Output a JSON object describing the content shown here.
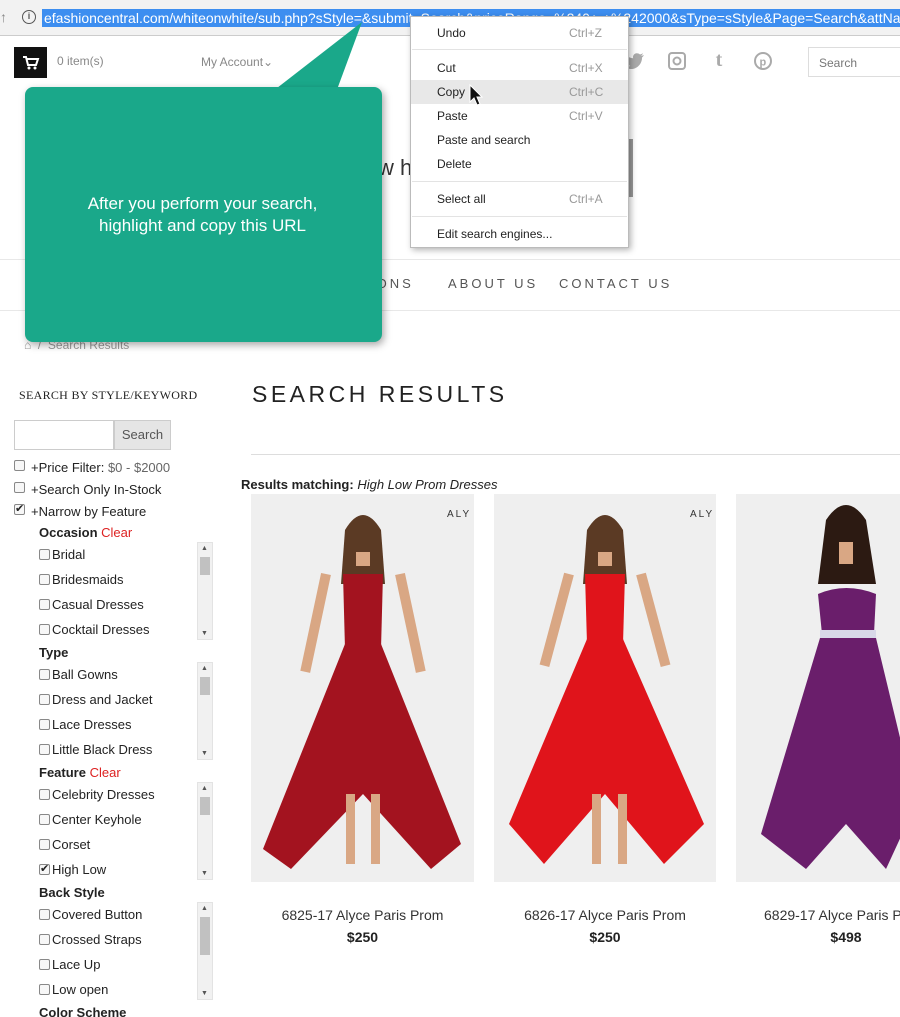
{
  "browser": {
    "url": "efashioncentral.com/whiteonwhite/sub.php?sStyle=&submit=Search&priceRange=%240+-+%242000&sType=sStyle&Page=Search&attNa"
  },
  "header": {
    "cart_count": "0 item(s)",
    "account": "My Account",
    "search_placeholder": "Search",
    "logo_fragment": "w h",
    "nav": [
      "IONS",
      "ABOUT US",
      "CONTACT US"
    ],
    "breadcrumb": "Search Results"
  },
  "callout": {
    "text": "After you perform your search, highlight and copy this URL",
    "color": "#1aa88a"
  },
  "context_menu": {
    "items": [
      {
        "label": "Undo",
        "shortcut": "Ctrl+Z"
      },
      {
        "label": "Cut",
        "shortcut": "Ctrl+X"
      },
      {
        "label": "Copy",
        "shortcut": "Ctrl+C"
      },
      {
        "label": "Paste",
        "shortcut": "Ctrl+V"
      },
      {
        "label": "Paste and search",
        "shortcut": ""
      },
      {
        "label": "Delete",
        "shortcut": ""
      },
      {
        "label": "Select all",
        "shortcut": "Ctrl+A"
      },
      {
        "label": "Edit search engines...",
        "shortcut": ""
      }
    ]
  },
  "sidebar": {
    "heading": "SEARCH BY STYLE/KEYWORD",
    "search_button": "Search",
    "filters": {
      "price_label": "+Price Filter:",
      "price_value": "$0 - $2000",
      "in_stock": "+Search Only In-Stock",
      "narrow": "+Narrow by Feature"
    },
    "clear_label": "Clear",
    "groups": {
      "occasion": {
        "title": "Occasion",
        "options": [
          "Bridal",
          "Bridesmaids",
          "Casual Dresses",
          "Cocktail Dresses"
        ]
      },
      "type": {
        "title": "Type",
        "options": [
          "Ball Gowns",
          "Dress and Jacket",
          "Lace Dresses",
          "Little Black Dress"
        ]
      },
      "feature": {
        "title": "Feature",
        "options": [
          "Celebrity Dresses",
          "Center Keyhole",
          "Corset",
          "High Low"
        ]
      },
      "back_style": {
        "title": "Back Style",
        "options": [
          "Covered Button",
          "Crossed Straps",
          "Lace Up",
          "Low open"
        ]
      },
      "color_scheme": {
        "title": "Color Scheme"
      }
    }
  },
  "results": {
    "title": "SEARCH RESULTS",
    "matching_label": "Results matching:",
    "matching_query": "High Low Prom Dresses",
    "brand_logo": "ALY",
    "products": [
      {
        "name": "6825-17 Alyce Paris Prom",
        "price": "$250",
        "dress_color": "#a3131f"
      },
      {
        "name": "6826-17 Alyce Paris Prom",
        "price": "$250",
        "dress_color": "#e0141b"
      },
      {
        "name": "6829-17 Alyce Paris P",
        "price": "$498",
        "dress_color": "#6a1e6b"
      }
    ]
  }
}
